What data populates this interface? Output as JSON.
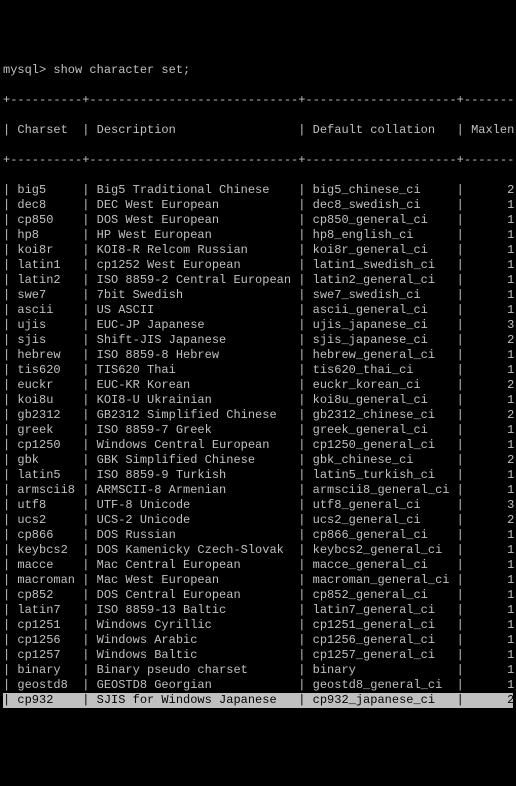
{
  "prompt": "mysql> show character set;",
  "sep": "+----------+-----------------------------+---------------------+--------+",
  "header": {
    "charset": "Charset",
    "description": "Description",
    "collation": "Default collation",
    "maxlen": "Maxlen"
  },
  "rows": [
    {
      "c": "big5",
      "d": "Big5 Traditional Chinese",
      "co": "big5_chinese_ci",
      "m": "2"
    },
    {
      "c": "dec8",
      "d": "DEC West European",
      "co": "dec8_swedish_ci",
      "m": "1"
    },
    {
      "c": "cp850",
      "d": "DOS West European",
      "co": "cp850_general_ci",
      "m": "1"
    },
    {
      "c": "hp8",
      "d": "HP West European",
      "co": "hp8_english_ci",
      "m": "1"
    },
    {
      "c": "koi8r",
      "d": "KOI8-R Relcom Russian",
      "co": "koi8r_general_ci",
      "m": "1"
    },
    {
      "c": "latin1",
      "d": "cp1252 West European",
      "co": "latin1_swedish_ci",
      "m": "1"
    },
    {
      "c": "latin2",
      "d": "ISO 8859-2 Central European",
      "co": "latin2_general_ci",
      "m": "1"
    },
    {
      "c": "swe7",
      "d": "7bit Swedish",
      "co": "swe7_swedish_ci",
      "m": "1"
    },
    {
      "c": "ascii",
      "d": "US ASCII",
      "co": "ascii_general_ci",
      "m": "1"
    },
    {
      "c": "ujis",
      "d": "EUC-JP Japanese",
      "co": "ujis_japanese_ci",
      "m": "3"
    },
    {
      "c": "sjis",
      "d": "Shift-JIS Japanese",
      "co": "sjis_japanese_ci",
      "m": "2"
    },
    {
      "c": "hebrew",
      "d": "ISO 8859-8 Hebrew",
      "co": "hebrew_general_ci",
      "m": "1"
    },
    {
      "c": "tis620",
      "d": "TIS620 Thai",
      "co": "tis620_thai_ci",
      "m": "1"
    },
    {
      "c": "euckr",
      "d": "EUC-KR Korean",
      "co": "euckr_korean_ci",
      "m": "2"
    },
    {
      "c": "koi8u",
      "d": "KOI8-U Ukrainian",
      "co": "koi8u_general_ci",
      "m": "1"
    },
    {
      "c": "gb2312",
      "d": "GB2312 Simplified Chinese",
      "co": "gb2312_chinese_ci",
      "m": "2"
    },
    {
      "c": "greek",
      "d": "ISO 8859-7 Greek",
      "co": "greek_general_ci",
      "m": "1"
    },
    {
      "c": "cp1250",
      "d": "Windows Central European",
      "co": "cp1250_general_ci",
      "m": "1"
    },
    {
      "c": "gbk",
      "d": "GBK Simplified Chinese",
      "co": "gbk_chinese_ci",
      "m": "2"
    },
    {
      "c": "latin5",
      "d": "ISO 8859-9 Turkish",
      "co": "latin5_turkish_ci",
      "m": "1"
    },
    {
      "c": "armscii8",
      "d": "ARMSCII-8 Armenian",
      "co": "armscii8_general_ci",
      "m": "1"
    },
    {
      "c": "utf8",
      "d": "UTF-8 Unicode",
      "co": "utf8_general_ci",
      "m": "3"
    },
    {
      "c": "ucs2",
      "d": "UCS-2 Unicode",
      "co": "ucs2_general_ci",
      "m": "2"
    },
    {
      "c": "cp866",
      "d": "DOS Russian",
      "co": "cp866_general_ci",
      "m": "1"
    },
    {
      "c": "keybcs2",
      "d": "DOS Kamenicky Czech-Slovak",
      "co": "keybcs2_general_ci",
      "m": "1"
    },
    {
      "c": "macce",
      "d": "Mac Central European",
      "co": "macce_general_ci",
      "m": "1"
    },
    {
      "c": "macroman",
      "d": "Mac West European",
      "co": "macroman_general_ci",
      "m": "1"
    },
    {
      "c": "cp852",
      "d": "DOS Central European",
      "co": "cp852_general_ci",
      "m": "1"
    },
    {
      "c": "latin7",
      "d": "ISO 8859-13 Baltic",
      "co": "latin7_general_ci",
      "m": "1"
    },
    {
      "c": "cp1251",
      "d": "Windows Cyrillic",
      "co": "cp1251_general_ci",
      "m": "1"
    },
    {
      "c": "cp1256",
      "d": "Windows Arabic",
      "co": "cp1256_general_ci",
      "m": "1"
    },
    {
      "c": "cp1257",
      "d": "Windows Baltic",
      "co": "cp1257_general_ci",
      "m": "1"
    },
    {
      "c": "binary",
      "d": "Binary pseudo charset",
      "co": "binary",
      "m": "1"
    },
    {
      "c": "geostd8",
      "d": "GEOSTD8 Georgian",
      "co": "geostd8_general_ci",
      "m": "1"
    },
    {
      "c": "cp932",
      "d": "SJIS for Windows Japanese",
      "co": "cp932_japanese_ci",
      "m": "2",
      "hl": true
    }
  ],
  "widths": {
    "c": 8,
    "d": 27,
    "co": 19,
    "m": 6
  }
}
